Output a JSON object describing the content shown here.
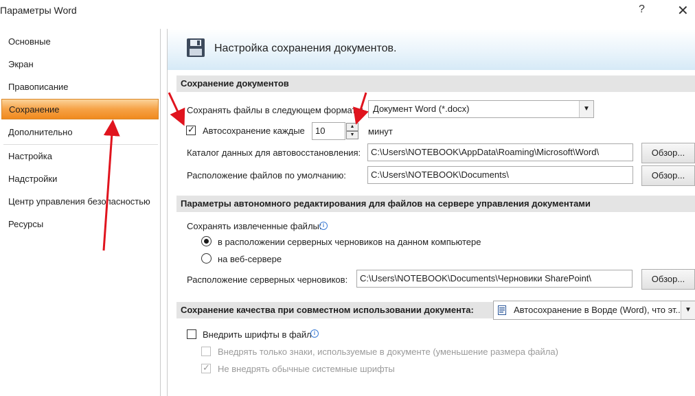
{
  "window": {
    "title": "Параметры Word",
    "help_label": "?",
    "close_label": "✕"
  },
  "sidebar": {
    "items": [
      {
        "label": "Основные"
      },
      {
        "label": "Экран"
      },
      {
        "label": "Правописание"
      },
      {
        "label": "Сохранение"
      },
      {
        "label": "Дополнительно"
      },
      {
        "label": "Настройка"
      },
      {
        "label": "Надстройки"
      },
      {
        "label": "Центр управления безопасностью"
      },
      {
        "label": "Ресурсы"
      }
    ]
  },
  "main": {
    "header": "Настройка сохранения документов.",
    "save": {
      "section": "Сохранение документов",
      "format_label": "Сохранять файлы в следующем формате:",
      "format_value": "Документ Word (*.docx)",
      "autosave_label": "Автосохранение каждые",
      "autosave_value": "10",
      "autosave_unit": "минут",
      "autorecover_label": "Каталог данных для автовосстановления:",
      "autorecover_path": "C:\\Users\\NOTEBOOK\\AppData\\Roaming\\Microsoft\\Word\\",
      "default_label": "Расположение файлов по умолчанию:",
      "default_path": "C:\\Users\\NOTEBOOK\\Documents\\",
      "browse_label": "Обзор..."
    },
    "offline": {
      "section": "Параметры автономного редактирования для файлов на сервере управления документами",
      "save_extracted_label": "Сохранять извлеченные файлы:",
      "option_local": "в расположении серверных черновиков на данном компьютере",
      "option_web": "на веб-сервере",
      "drafts_label": "Расположение серверных черновиков:",
      "drafts_path": "C:\\Users\\NOTEBOOK\\Documents\\Черновики SharePoint\\",
      "browse_label": "Обзор..."
    },
    "fidelity": {
      "section": "Сохранение качества при совместном использовании документа:",
      "doc_value": "Автосохранение в Ворде (Word), что эт...",
      "embed_fonts": "Внедрить шрифты в файл",
      "embed_used": "Внедрять только знаки, используемые в документе (уменьшение размера файла)",
      "no_common": "Не внедрять обычные системные шрифты"
    }
  },
  "colors": {
    "selected_nav": "#f6a246",
    "annotation_arrow": "#e0141e",
    "banner": "#d6eaf7"
  }
}
